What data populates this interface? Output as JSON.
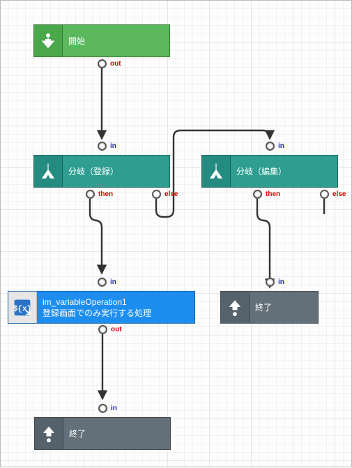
{
  "nodes": {
    "start": {
      "label": "開始"
    },
    "branchReg": {
      "label": "分岐（登録）"
    },
    "branchEdit": {
      "label": "分岐（編集）"
    },
    "action": {
      "title": "im_variableOperation1",
      "subtitle": "登録画面でのみ実行する処理"
    },
    "end1": {
      "label": "終了"
    },
    "end2": {
      "label": "終了"
    }
  },
  "ports": {
    "out": "out",
    "in": "in",
    "then": "then",
    "else": "else"
  }
}
